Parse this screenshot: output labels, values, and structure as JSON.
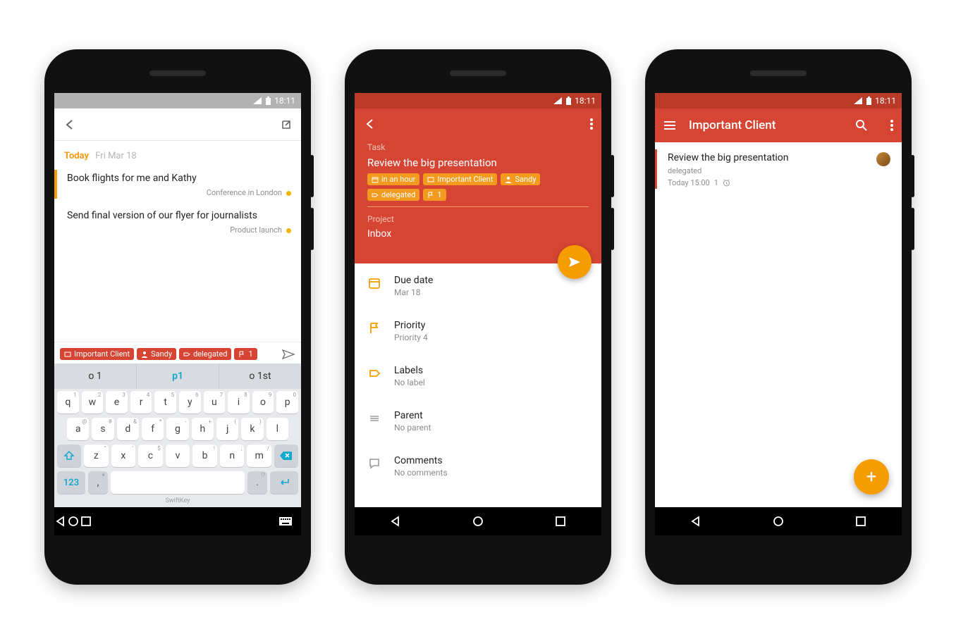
{
  "status": {
    "time": "18:11"
  },
  "colors": {
    "brand_red": "#d64534",
    "accent_orange": "#f59c00"
  },
  "screen1": {
    "date_today_label": "Today",
    "date_full": "Fri Mar 18",
    "tasks": [
      {
        "title": "Book flights for me and Kathy",
        "meta": "Conference in London"
      },
      {
        "title": "Send final version of our flyer for journalists",
        "meta": "Product launch"
      }
    ],
    "compose_chips": [
      {
        "icon": "project",
        "label": "Important Client"
      },
      {
        "icon": "person",
        "label": "Sandy"
      },
      {
        "icon": "tag",
        "label": "delegated"
      },
      {
        "icon": "flag",
        "label": "1"
      }
    ],
    "keyboard": {
      "suggestions": [
        "o 1",
        "p1",
        "o 1st"
      ],
      "row1": [
        {
          "k": "q",
          "h": "1"
        },
        {
          "k": "w",
          "h": "2"
        },
        {
          "k": "e",
          "h": "3"
        },
        {
          "k": "r",
          "h": "4"
        },
        {
          "k": "t",
          "h": "5"
        },
        {
          "k": "y",
          "h": "6"
        },
        {
          "k": "u",
          "h": "7"
        },
        {
          "k": "i",
          "h": "8"
        },
        {
          "k": "o",
          "h": "9"
        },
        {
          "k": "p",
          "h": "0"
        }
      ],
      "row2": [
        {
          "k": "a",
          "h": "@"
        },
        {
          "k": "s",
          "h": "#"
        },
        {
          "k": "d",
          "h": "&"
        },
        {
          "k": "f",
          "h": "*"
        },
        {
          "k": "g",
          "h": "-"
        },
        {
          "k": "h",
          "h": "+"
        },
        {
          "k": "j",
          "h": "("
        },
        {
          "k": "k",
          "h": ")"
        },
        {
          "k": "l",
          "h": ""
        }
      ],
      "row3": [
        {
          "k": "z",
          "h": "\""
        },
        {
          "k": "x",
          "h": "'"
        },
        {
          "k": "c",
          "h": "$"
        },
        {
          "k": "v",
          "h": ""
        },
        {
          "k": "b",
          "h": "!"
        },
        {
          "k": "n",
          "h": ";"
        },
        {
          "k": "m",
          "h": "/"
        }
      ],
      "numkey": "123",
      "brand": "SwiftKey"
    }
  },
  "screen2": {
    "section_task": "Task",
    "task_title": "Review the big presentation",
    "chips": [
      {
        "icon": "calendar",
        "label": "in an hour"
      },
      {
        "icon": "project",
        "label": "Important Client"
      },
      {
        "icon": "person",
        "label": "Sandy"
      },
      {
        "icon": "tag",
        "label": "delegated"
      },
      {
        "icon": "flag",
        "label": "1"
      }
    ],
    "section_project": "Project",
    "project_value": "Inbox",
    "rows": [
      {
        "icon": "calendar",
        "k": "Due date",
        "v": "Mar 18"
      },
      {
        "icon": "flag",
        "k": "Priority",
        "v": "Priority 4"
      },
      {
        "icon": "tag",
        "k": "Labels",
        "v": "No label"
      },
      {
        "icon": "parent",
        "k": "Parent",
        "v": "No parent"
      },
      {
        "icon": "comment",
        "k": "Comments",
        "v": "No comments"
      }
    ]
  },
  "screen3": {
    "title": "Important Client",
    "item": {
      "title": "Review the big presentation",
      "sub": "delegated",
      "time": "Today 15:00",
      "count": "1"
    }
  }
}
